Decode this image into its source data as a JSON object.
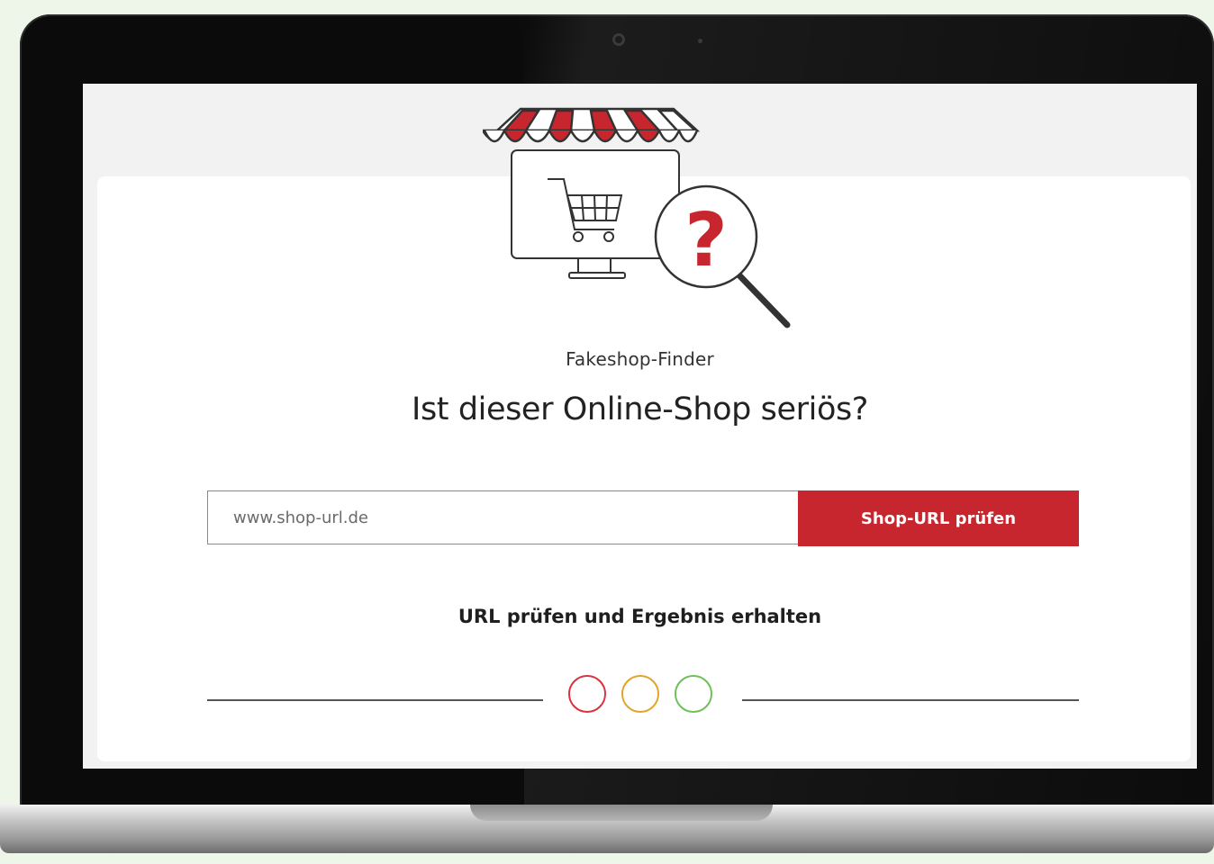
{
  "app": {
    "subtitle": "Fakeshop-Finder",
    "headline": "Ist dieser Online-Shop seriös?"
  },
  "search": {
    "placeholder": "www.shop-url.de",
    "value": "",
    "button_label": "Shop-URL prüfen"
  },
  "result": {
    "label": "URL prüfen und Ergebnis erhalten",
    "lights": [
      {
        "name": "red",
        "color": "#d9343d"
      },
      {
        "name": "yellow",
        "color": "#e2a52a"
      },
      {
        "name": "green",
        "color": "#6fbf5a"
      }
    ]
  },
  "colors": {
    "accent": "#c8262e",
    "awning_red": "#c8262e",
    "question_mark": "#c8262e"
  },
  "illustration": {
    "icons": [
      "shop-awning-icon",
      "shopping-cart-icon",
      "monitor-icon",
      "magnifier-question-icon"
    ],
    "question_mark": "?"
  }
}
